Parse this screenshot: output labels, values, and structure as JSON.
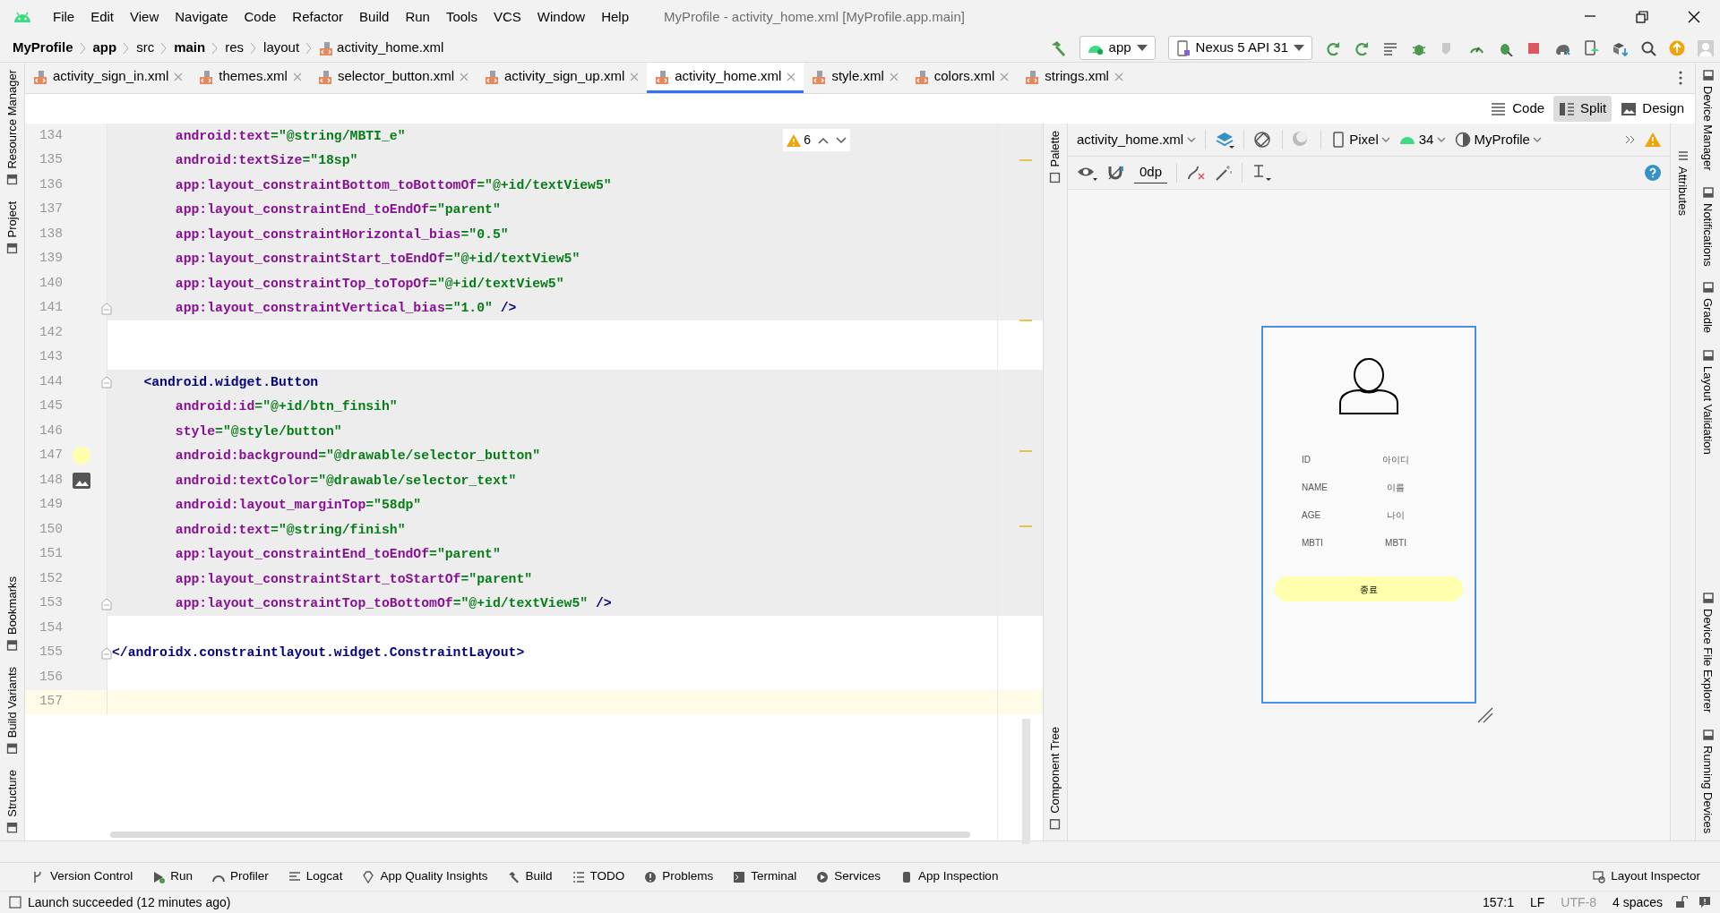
{
  "window": {
    "title": "MyProfile - activity_home.xml [MyProfile.app.main]"
  },
  "menu": [
    "File",
    "Edit",
    "View",
    "Navigate",
    "Code",
    "Refactor",
    "Build",
    "Run",
    "Tools",
    "VCS",
    "Window",
    "Help"
  ],
  "breadcrumb": [
    {
      "label": "MyProfile",
      "bold": true
    },
    {
      "label": "app",
      "bold": true
    },
    {
      "label": "src",
      "bold": false
    },
    {
      "label": "main",
      "bold": true
    },
    {
      "label": "res",
      "bold": false
    },
    {
      "label": "layout",
      "bold": false
    },
    {
      "label": "activity_home.xml",
      "bold": false
    }
  ],
  "toolbar": {
    "run_config": "app",
    "device": "Nexus 5 API 31"
  },
  "tabs": [
    {
      "label": "activity_sign_in.xml",
      "selected": false
    },
    {
      "label": "themes.xml",
      "selected": false
    },
    {
      "label": "selector_button.xml",
      "selected": false
    },
    {
      "label": "activity_sign_up.xml",
      "selected": false
    },
    {
      "label": "activity_home.xml",
      "selected": true
    },
    {
      "label": "style.xml",
      "selected": false
    },
    {
      "label": "colors.xml",
      "selected": false
    },
    {
      "label": "strings.xml",
      "selected": false
    }
  ],
  "editor_modes": [
    {
      "label": "Code",
      "selected": false
    },
    {
      "label": "Split",
      "selected": true
    },
    {
      "label": "Design",
      "selected": false
    }
  ],
  "inspection": {
    "warnings": "6"
  },
  "code_lines": [
    {
      "number": "134",
      "code": "        android:text=\"@string/MBTI_e\"",
      "highlighted": true,
      "current": false
    },
    {
      "number": "135",
      "code": "        android:textSize=\"18sp\"",
      "highlighted": true,
      "current": false
    },
    {
      "number": "136",
      "code": "        app:layout_constraintBottom_toBottomOf=\"@+id/textView5\"",
      "highlighted": true,
      "current": false
    },
    {
      "number": "137",
      "code": "        app:layout_constraintEnd_toEndOf=\"parent\"",
      "highlighted": true,
      "current": false
    },
    {
      "number": "138",
      "code": "        app:layout_constraintHorizontal_bias=\"0.5\"",
      "highlighted": true,
      "current": false
    },
    {
      "number": "139",
      "code": "        app:layout_constraintStart_toEndOf=\"@+id/textView5\"",
      "highlighted": true,
      "current": false
    },
    {
      "number": "140",
      "code": "        app:layout_constraintTop_toTopOf=\"@+id/textView5\"",
      "highlighted": true,
      "current": false
    },
    {
      "number": "141",
      "code": "        app:layout_constraintVertical_bias=\"1.0\" />",
      "highlighted": true,
      "current": false,
      "kind": "fold"
    },
    {
      "number": "142",
      "highlighted": false,
      "current": false
    },
    {
      "number": "143",
      "highlighted": false,
      "current": false
    },
    {
      "number": "144",
      "code": "    <android.widget.Button",
      "highlighted": true,
      "current": false,
      "kind": "fold"
    },
    {
      "number": "145",
      "code": "        android:id=\"@+id/btn_finsih\"",
      "highlighted": true,
      "current": false
    },
    {
      "number": "146",
      "code": "        style=\"@style/button\"",
      "highlighted": true,
      "current": false
    },
    {
      "number": "147",
      "code": "        android:background=\"@drawable/selector_button\"",
      "highlighted": true,
      "current": false,
      "kind": "color"
    },
    {
      "number": "148",
      "code": "        android:textColor=\"@drawable/selector_text\"",
      "highlighted": true,
      "current": false,
      "kind": "image"
    },
    {
      "number": "149",
      "code": "        android:layout_marginTop=\"58dp\"",
      "highlighted": true,
      "current": false
    },
    {
      "number": "150",
      "code": "        android:text=\"@string/finish\"",
      "highlighted": true,
      "current": false
    },
    {
      "number": "151",
      "code": "        app:layout_constraintEnd_toEndOf=\"parent\"",
      "highlighted": true,
      "current": false
    },
    {
      "number": "152",
      "code": "        app:layout_constraintStart_toStartOf=\"parent\"",
      "highlighted": true,
      "current": false
    },
    {
      "number": "153",
      "code": "        app:layout_constraintTop_toBottomOf=\"@+id/textView5\" />",
      "highlighted": true,
      "current": false,
      "kind": "fold"
    },
    {
      "number": "154",
      "highlighted": false,
      "current": false
    },
    {
      "number": "155",
      "code": "</androidx.constraintlayout.widget.ConstraintLayout>",
      "highlighted": false,
      "current": false,
      "kind": "fold"
    },
    {
      "number": "156",
      "highlighted": false,
      "current": false
    },
    {
      "number": "157",
      "highlighted": false,
      "current": true
    }
  ],
  "design": {
    "file": "activity_home.xml",
    "device": "Pixel",
    "api": "34",
    "theme": "MyProfile",
    "margin": "0dp",
    "preview": {
      "rows": [
        {
          "label": "ID",
          "value": "아이디"
        },
        {
          "label": "NAME",
          "value": "이름"
        },
        {
          "label": "AGE",
          "value": "나이"
        },
        {
          "label": "MBTI",
          "value": "MBTI"
        }
      ],
      "button": "종료"
    }
  },
  "side_panels": {
    "left_top": [
      "Resource Manager",
      "Project"
    ],
    "left_bottom": [
      "Bookmarks",
      "Build Variants",
      "Structure"
    ],
    "palette": [
      "Palette"
    ],
    "component_tree": [
      "Component Tree"
    ],
    "attributes": [
      "Attributes"
    ],
    "right_top": [
      "Device Manager",
      "Notifications",
      "Gradle",
      "Layout Validation"
    ],
    "right_bottom": [
      "Device File Explorer",
      "Running Devices"
    ]
  },
  "tool_windows": {
    "left": [
      "Version Control",
      "Run",
      "Profiler",
      "Logcat",
      "App Quality Insights",
      "Build",
      "TODO",
      "Problems",
      "Terminal",
      "Services",
      "App Inspection"
    ],
    "right": [
      "Layout Inspector"
    ]
  },
  "status_bar": {
    "message": "Launch succeeded (12 minutes ago)",
    "position": "157:1",
    "line_separator": "LF",
    "encoding": "UTF-8",
    "indent": "4 spaces"
  }
}
